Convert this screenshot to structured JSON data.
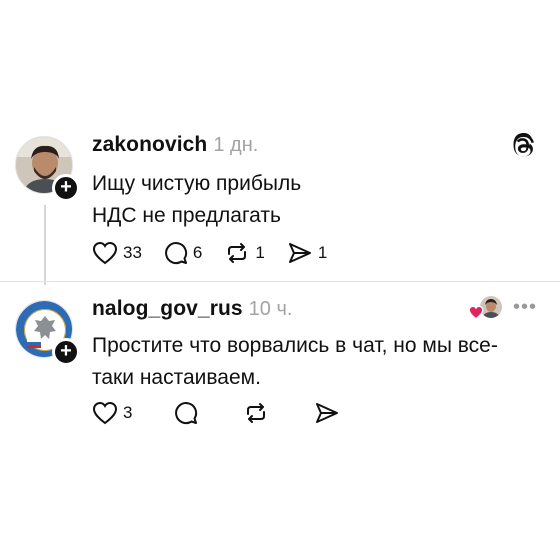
{
  "posts": [
    {
      "username": "zakonovich",
      "time": "1 дн.",
      "text": "Ищу чистую прибыль\nНДС не предлагать",
      "actions": {
        "likes": "33",
        "replies": "6",
        "reposts": "1",
        "shares": "1"
      }
    },
    {
      "username": "nalog_gov_rus",
      "time": "10 ч.",
      "text": "Простите что ворвались в чат, но мы все-\nтаки настаиваем.",
      "actions": {
        "likes": "3",
        "replies": "",
        "reposts": "",
        "shares": ""
      },
      "menu": "•••"
    }
  ],
  "app_icon": "threads-logo-icon",
  "colors": {
    "liked_heart": "#e0245e",
    "time_gray": "#a3a3a3",
    "thread_line": "#d6d6d6"
  }
}
